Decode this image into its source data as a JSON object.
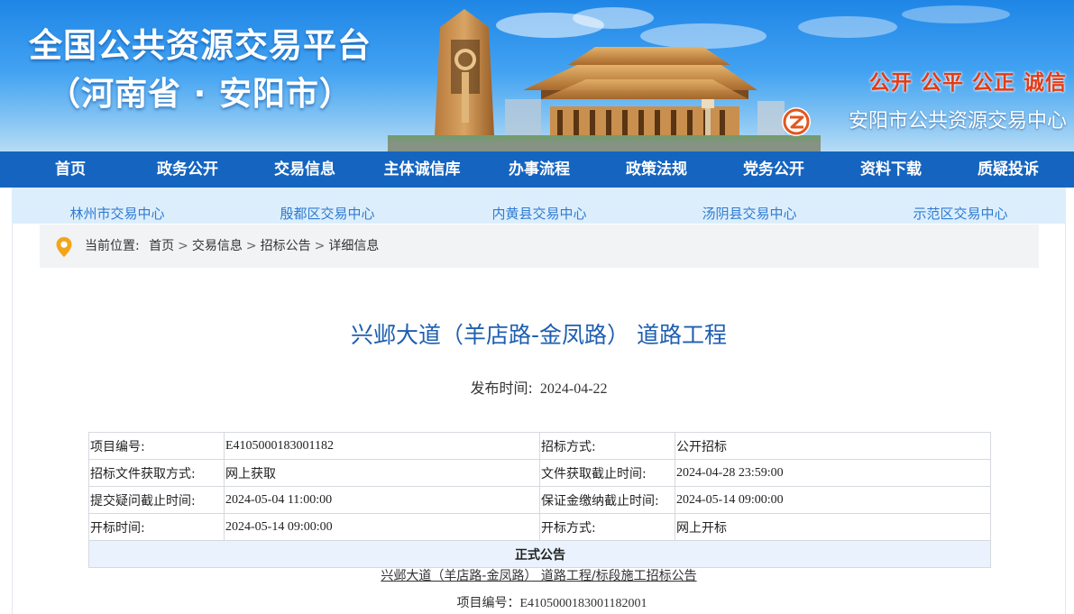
{
  "banner": {
    "platform_title": "全国公共资源交易平台",
    "platform_subtitle": "（河南省 · 安阳市）",
    "slogan": "公开 公平 公正 诚信",
    "center_name": "安阳市公共资源交易中心",
    "logo_icon": "center-logo-icon",
    "colors": {
      "sky": "#1f86e6",
      "slogan": "#e23b16"
    }
  },
  "nav": {
    "items": [
      "首页",
      "政务公开",
      "交易信息",
      "主体诚信库",
      "办事流程",
      "政策法规",
      "党务公开",
      "资料下载",
      "质疑投诉"
    ],
    "color": "#1565c0"
  },
  "subcenters": [
    "林州市交易中心",
    "殷都区交易中心",
    "内黄县交易中心",
    "汤阴县交易中心",
    "示范区交易中心"
  ],
  "breadcrumb": {
    "icon": "location-pin-icon",
    "label": "当前位置:",
    "items": [
      "首页",
      "交易信息",
      "招标公告",
      "详细信息"
    ],
    "separator": ">"
  },
  "article": {
    "title": "兴邺大道（羊店路-金凤路） 道路工程",
    "publish_label": "发布时间:",
    "publish_value": "2024-04-22"
  },
  "info_table": {
    "rows": [
      [
        "项目编号:",
        "E4105000183001182",
        "招标方式:",
        "公开招标"
      ],
      [
        "招标文件获取方式:",
        "网上获取",
        "文件获取截止时间:",
        "2024-04-28 23:59:00"
      ],
      [
        "提交疑问截止时间:",
        "2024-05-04 11:00:00",
        "保证金缴纳截止时间:",
        "2024-05-14 09:00:00"
      ],
      [
        "开标时间:",
        "2024-05-14 09:00:00",
        "开标方式:",
        "网上开标"
      ]
    ],
    "section_header": "正式公告"
  },
  "notice": {
    "link_text": "兴邺大道（羊店路-金凤路） 道路工程/标段施工招标公告",
    "project_no_label": "项目编号：",
    "project_no_value": "E4105000183001182001"
  }
}
